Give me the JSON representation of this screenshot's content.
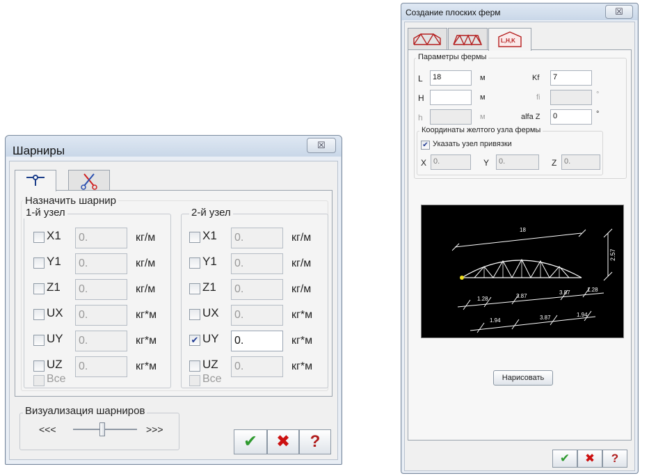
{
  "left_dialog": {
    "title": "Шарниры",
    "close_label": "☒",
    "tabs": [
      {
        "icon": "hinge-icon",
        "active": true
      },
      {
        "icon": "scissors-icon",
        "active": false
      }
    ],
    "assign_group_label": "Назначить шарнир",
    "node1": {
      "label": "1-й узел",
      "rows": [
        {
          "name": "X1",
          "value": "0.",
          "unit": "кг/м",
          "checked": false
        },
        {
          "name": "Y1",
          "value": "0.",
          "unit": "кг/м",
          "checked": false
        },
        {
          "name": "Z1",
          "value": "0.",
          "unit": "кг/м",
          "checked": false
        },
        {
          "name": "UX",
          "value": "0.",
          "unit": "кг*м",
          "checked": false
        },
        {
          "name": "UY",
          "value": "0.",
          "unit": "кг*м",
          "checked": false
        },
        {
          "name": "UZ",
          "value": "0.",
          "unit": "кг*м",
          "checked": false
        }
      ],
      "all_label": "Все"
    },
    "node2": {
      "label": "2-й узел",
      "rows": [
        {
          "name": "X1",
          "value": "0.",
          "unit": "кг/м",
          "checked": false
        },
        {
          "name": "Y1",
          "value": "0.",
          "unit": "кг/м",
          "checked": false
        },
        {
          "name": "Z1",
          "value": "0.",
          "unit": "кг/м",
          "checked": false
        },
        {
          "name": "UX",
          "value": "0.",
          "unit": "кг*м",
          "checked": false
        },
        {
          "name": "UY",
          "value": "0.",
          "unit": "кг*м",
          "checked": true
        },
        {
          "name": "UZ",
          "value": "0.",
          "unit": "кг*м",
          "checked": false
        }
      ],
      "all_label": "Все"
    },
    "visual_group_label": "Визуализация шарниров",
    "slider": {
      "left": "<<<",
      "right": ">>>",
      "level": 0.45
    },
    "buttons": {
      "ok": "✔",
      "cancel": "✖",
      "help": "?"
    }
  },
  "right_dialog": {
    "title": "Создание плоских ферм",
    "close_label": "☒",
    "tabs": [
      {
        "icon": "truss-type-1-icon",
        "active": false
      },
      {
        "icon": "truss-type-2-icon",
        "active": false
      },
      {
        "text": "L,H,K",
        "active": true
      }
    ],
    "params_label": "Параметры фермы",
    "fields": {
      "L": {
        "label": "L",
        "value": "18",
        "unit": "м"
      },
      "H": {
        "label": "H",
        "value": "",
        "unit": "м"
      },
      "h": {
        "label": "h",
        "value": "",
        "unit": "м"
      },
      "Kf": {
        "label": "Kf",
        "value": "7"
      },
      "fi": {
        "label": "fi",
        "value": "",
        "unit": "°"
      },
      "alfaZ": {
        "label": "alfa Z",
        "value": "0",
        "unit": "°"
      }
    },
    "coords_label": "Координаты желтого узла фермы",
    "anchor_checkbox": {
      "label": "Указать узел привязки",
      "checked": true
    },
    "coords": {
      "X": {
        "label": "X",
        "value": "0."
      },
      "Y": {
        "label": "Y",
        "value": "0."
      },
      "Z": {
        "label": "Z",
        "value": "0."
      }
    },
    "preview": {
      "span": "18",
      "height": "2.57",
      "top_dims": [
        "1.28",
        "3.87",
        "3.87",
        "1.28"
      ],
      "bottom_dims": [
        "1.94",
        "3.87",
        "1.94"
      ]
    },
    "draw_button": "Нарисовать",
    "buttons": {
      "ok": "✔",
      "cancel": "✖",
      "help": "?"
    }
  },
  "colors": {
    "accent_green": "#2f9a2f",
    "cancel_red": "#cc1111",
    "help_red": "#b01c1c",
    "preview_bg": "#000000",
    "node_yellow": "#f0e020"
  }
}
